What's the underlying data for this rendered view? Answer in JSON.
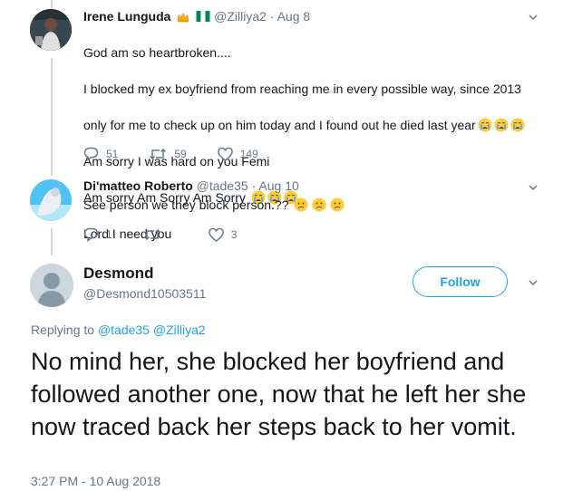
{
  "tweet1": {
    "name": "Irene Lunguda",
    "handle": "@Zilliya2",
    "separator": "·",
    "date": "Aug 8",
    "lines": [
      "God am so heartbroken....",
      "I blocked my ex boyfriend from reaching me in every possible way, since 2013",
      "only for me to check up on him today and I found out he died last year",
      "Am sorry I was hard on you Femi",
      "Am sorry Am Sorry Am Sorry",
      "Lord I need you"
    ],
    "replies": "51",
    "retweets": "59",
    "likes": "149",
    "badges": [
      "crown-icon",
      "nigeria-flag-icon"
    ],
    "line3_emojis": [
      "crying-face-icon",
      "crying-face-icon",
      "crying-face-icon"
    ],
    "line5_emojis": [
      "crying-face-icon",
      "crying-face-icon",
      "crying-face-icon"
    ]
  },
  "tweet2": {
    "name": "Di'matteo Roberto",
    "handle": "@tade35",
    "separator": "·",
    "date": "Aug 10",
    "text": "See person we they block person.??",
    "emojis": [
      "confused-face-icon",
      "confused-face-icon",
      "confused-face-icon"
    ],
    "replies": "1",
    "retweets": "",
    "likes": "3"
  },
  "main_tweet": {
    "name": "Desmond",
    "handle": "@Desmond10503511",
    "follow_label": "Follow",
    "replying_prefix": "Replying to",
    "replying_to": [
      "@tade35",
      "@Zilliya2"
    ],
    "text": "No mind her, she blocked her boyfriend and followed another one, now that he left her she now traced back her steps back to her vomit.",
    "timestamp": "3:27 PM - 10 Aug 2018"
  },
  "colors": {
    "accent": "#1da1f2",
    "secondary_text": "#657786",
    "thread_line": "#ccd6dd"
  }
}
